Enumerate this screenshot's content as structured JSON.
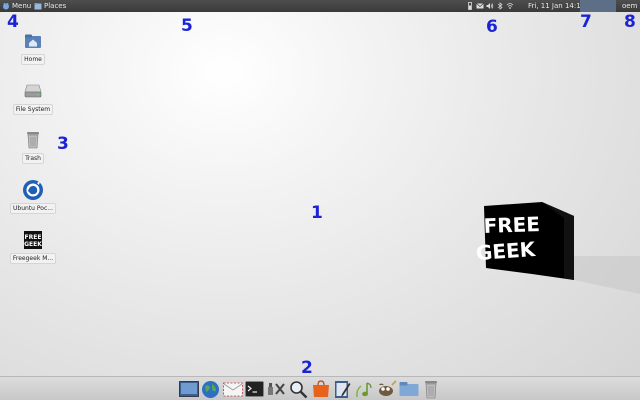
{
  "top_panel": {
    "menu_label": "Menu",
    "places_label": "Places",
    "clock": "Fri, 11 Jan  14:14",
    "user": "oem",
    "workspaces": 2
  },
  "desktop_icons": [
    {
      "label": "Home",
      "icon": "home-folder-icon"
    },
    {
      "label": "File System",
      "icon": "drive-icon"
    },
    {
      "label": "Trash",
      "icon": "trash-icon"
    },
    {
      "label": "Ubuntu Poc...",
      "icon": "ubuntu-pocket-guide-icon"
    },
    {
      "label": "Freegeek M...",
      "icon": "freegeek-manual-icon"
    }
  ],
  "wallpaper_logo": {
    "line1": "FREE",
    "line2": "GEEK"
  },
  "annotations": [
    "1",
    "2",
    "3",
    "4",
    "5",
    "6",
    "7",
    "8"
  ],
  "dock_items": [
    "show-desktop-icon",
    "web-browser-icon",
    "mail-icon",
    "terminal-icon",
    "settings-manager-icon",
    "search-icon",
    "software-center-icon",
    "text-editor-icon",
    "audio-player-icon",
    "gimp-icon",
    "file-manager-icon",
    "trash-icon"
  ],
  "colors": {
    "annotation": "#1a23d6",
    "panel": "#3a3a3a"
  }
}
